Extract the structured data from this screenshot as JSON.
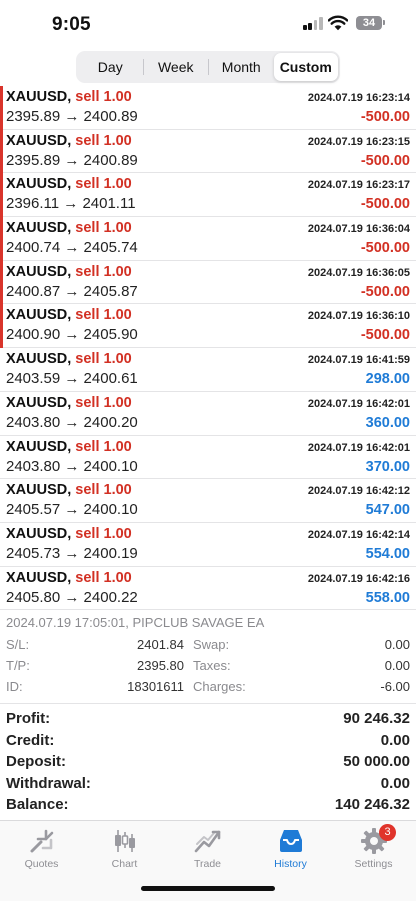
{
  "status_bar": {
    "time": "9:05",
    "battery": "34"
  },
  "period_tabs": [
    {
      "label": "Day",
      "active": false
    },
    {
      "label": "Week",
      "active": false
    },
    {
      "label": "Month",
      "active": false
    },
    {
      "label": "Custom",
      "active": true
    }
  ],
  "deals": [
    {
      "symbol": "XAUUSD,",
      "side": "sell 1.00",
      "prices": "2395.89 → 2400.89",
      "time": "2024.07.19 16:23:14",
      "profit": "-500.00",
      "negative": true
    },
    {
      "symbol": "XAUUSD,",
      "side": "sell 1.00",
      "prices": "2395.89 → 2400.89",
      "time": "2024.07.19 16:23:15",
      "profit": "-500.00",
      "negative": true
    },
    {
      "symbol": "XAUUSD,",
      "side": "sell 1.00",
      "prices": "2396.11 → 2401.11",
      "time": "2024.07.19 16:23:17",
      "profit": "-500.00",
      "negative": true
    },
    {
      "symbol": "XAUUSD,",
      "side": "sell 1.00",
      "prices": "2400.74 → 2405.74",
      "time": "2024.07.19 16:36:04",
      "profit": "-500.00",
      "negative": true
    },
    {
      "symbol": "XAUUSD,",
      "side": "sell 1.00",
      "prices": "2400.87 → 2405.87",
      "time": "2024.07.19 16:36:05",
      "profit": "-500.00",
      "negative": true
    },
    {
      "symbol": "XAUUSD,",
      "side": "sell 1.00",
      "prices": "2400.90 → 2405.90",
      "time": "2024.07.19 16:36:10",
      "profit": "-500.00",
      "negative": true
    },
    {
      "symbol": "XAUUSD,",
      "side": "sell 1.00",
      "prices": "2403.59 → 2400.61",
      "time": "2024.07.19 16:41:59",
      "profit": "298.00",
      "negative": false
    },
    {
      "symbol": "XAUUSD,",
      "side": "sell 1.00",
      "prices": "2403.80 → 2400.20",
      "time": "2024.07.19 16:42:01",
      "profit": "360.00",
      "negative": false
    },
    {
      "symbol": "XAUUSD,",
      "side": "sell 1.00",
      "prices": "2403.80 → 2400.10",
      "time": "2024.07.19 16:42:01",
      "profit": "370.00",
      "negative": false
    },
    {
      "symbol": "XAUUSD,",
      "side": "sell 1.00",
      "prices": "2405.57 → 2400.10",
      "time": "2024.07.19 16:42:12",
      "profit": "547.00",
      "negative": false
    },
    {
      "symbol": "XAUUSD,",
      "side": "sell 1.00",
      "prices": "2405.73 → 2400.19",
      "time": "2024.07.19 16:42:14",
      "profit": "554.00",
      "negative": false
    },
    {
      "symbol": "XAUUSD,",
      "side": "sell 1.00",
      "prices": "2405.80 → 2400.22",
      "time": "2024.07.19 16:42:16",
      "profit": "558.00",
      "negative": false
    }
  ],
  "deal_details": {
    "time_comment": "2024.07.19 17:05:01, PIPCLUB SAVAGE EA",
    "rows": [
      {
        "label": "S/L:",
        "value": "2401.84",
        "label2": "Swap:",
        "value2": "0.00"
      },
      {
        "label": "T/P:",
        "value": "2395.80",
        "label2": "Taxes:",
        "value2": "0.00"
      },
      {
        "label": "ID:",
        "value": "18301611",
        "label2": "Charges:",
        "value2": "-6.00"
      }
    ]
  },
  "totals": [
    {
      "label": "Profit:",
      "value": "90 246.32"
    },
    {
      "label": "Credit:",
      "value": "0.00"
    },
    {
      "label": "Deposit:",
      "value": "50 000.00"
    },
    {
      "label": "Withdrawal:",
      "value": "0.00"
    },
    {
      "label": "Balance:",
      "value": "140 246.32"
    }
  ],
  "tab_bar": [
    {
      "label": "Quotes",
      "icon": "quotes-icon",
      "active": false
    },
    {
      "label": "Chart",
      "icon": "chart-icon",
      "active": false
    },
    {
      "label": "Trade",
      "icon": "trade-icon",
      "active": false
    },
    {
      "label": "History",
      "icon": "history-icon",
      "active": true
    },
    {
      "label": "Settings",
      "icon": "settings-icon",
      "active": false,
      "badge": "3"
    }
  ],
  "colors": {
    "loss": "#d23023",
    "profit": "#1f7bd6",
    "accent": "#1f7bd6"
  }
}
